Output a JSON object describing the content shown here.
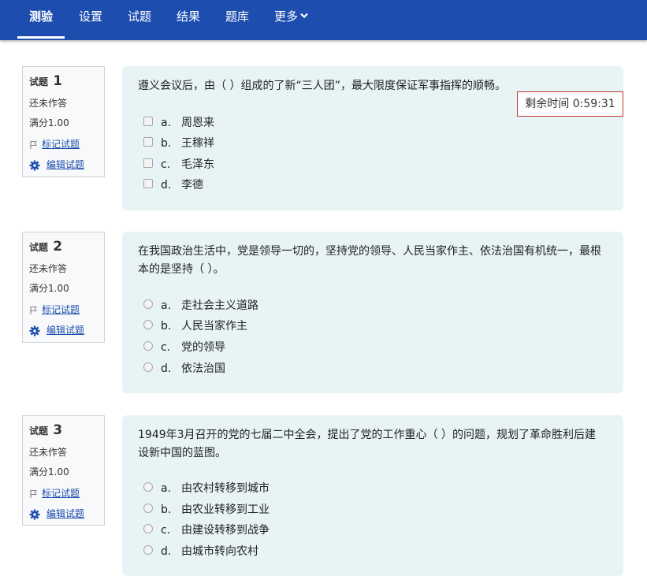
{
  "nav": {
    "items": [
      {
        "label": "测验"
      },
      {
        "label": "设置"
      },
      {
        "label": "试题"
      },
      {
        "label": "结果"
      },
      {
        "label": "题库"
      },
      {
        "label": "更多"
      }
    ]
  },
  "timer": {
    "label": "剩余时间",
    "value": "0:59:31"
  },
  "questions": [
    {
      "prefix": "试题",
      "number": "1",
      "state": "还未作答",
      "grade": "满分1.00",
      "flag_label": "标记试题",
      "edit_label": "编辑试题",
      "text": "遵义会议后，由（ ）组成的了新“三人团”，最大限度保证军事指挥的顺畅。",
      "options": [
        {
          "letter": "a.",
          "text": "周恩来"
        },
        {
          "letter": "b.",
          "text": "王稼祥"
        },
        {
          "letter": "c.",
          "text": "毛泽东"
        },
        {
          "letter": "d.",
          "text": "李德"
        }
      ]
    },
    {
      "prefix": "试题",
      "number": "2",
      "state": "还未作答",
      "grade": "满分1.00",
      "flag_label": "标记试题",
      "edit_label": "编辑试题",
      "text": "在我国政治生活中，党是领导一切的，坚持党的领导、人民当家作主、依法治国有机统一，最根本的是坚持（ ）。",
      "options": [
        {
          "letter": "a.",
          "text": "走社会主义道路"
        },
        {
          "letter": "b.",
          "text": "人民当家作主"
        },
        {
          "letter": "c.",
          "text": "党的领导"
        },
        {
          "letter": "d.",
          "text": "依法治国"
        }
      ]
    },
    {
      "prefix": "试题",
      "number": "3",
      "state": "还未作答",
      "grade": "满分1.00",
      "flag_label": "标记试题",
      "edit_label": "编辑试题",
      "text": "1949年3月召开的党的七届二中全会，提出了党的工作重心（ ）的问题，规划了革命胜利后建设新中国的蓝图。",
      "options": [
        {
          "letter": "a.",
          "text": "由农村转移到城市"
        },
        {
          "letter": "b.",
          "text": "由农业转移到工业"
        },
        {
          "letter": "c.",
          "text": "由建设转移到战争"
        },
        {
          "letter": "d.",
          "text": "由城市转向农村"
        }
      ]
    }
  ]
}
